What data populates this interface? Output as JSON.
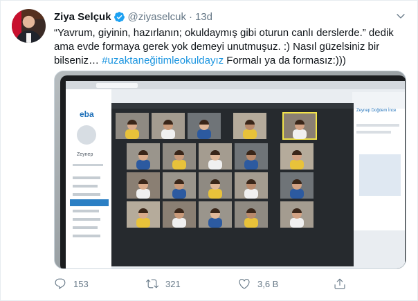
{
  "tweet": {
    "author_name": "Ziya Selçuk",
    "handle": "@ziyaselcuk",
    "separator": "·",
    "timestamp": "13d",
    "text_lines": [
      "“Yavrum, giyinin, hazırlanın; okuldaymış gibi oturun canlı derslerde.” dedik",
      "ama evde formaya gerek yok demeyi unutmuşuz. :) Nasıl güzelsiniz bir",
      "bilseniz… "
    ],
    "hashtag": "#uzaktaneğitimleokuldayız",
    "text_tail": " Formalı ya da formasız:)))"
  },
  "media": {
    "app_logo": "eba",
    "sidebar_user": "Zeynep",
    "presenter_label": "Zeynep Doğdem İnce",
    "participant_count": 20
  },
  "actions": {
    "replies": "153",
    "retweets": "321",
    "likes": "3,6 B"
  },
  "icons": {
    "verified": "verified-badge-icon",
    "caret": "chevron-down-icon",
    "reply": "reply-icon",
    "retweet": "retweet-icon",
    "like": "heart-icon",
    "share": "share-icon"
  },
  "colors": {
    "accent": "#1da1f2",
    "hashtag": "#1b95e0",
    "muted": "#657786",
    "text": "#0f1419"
  }
}
